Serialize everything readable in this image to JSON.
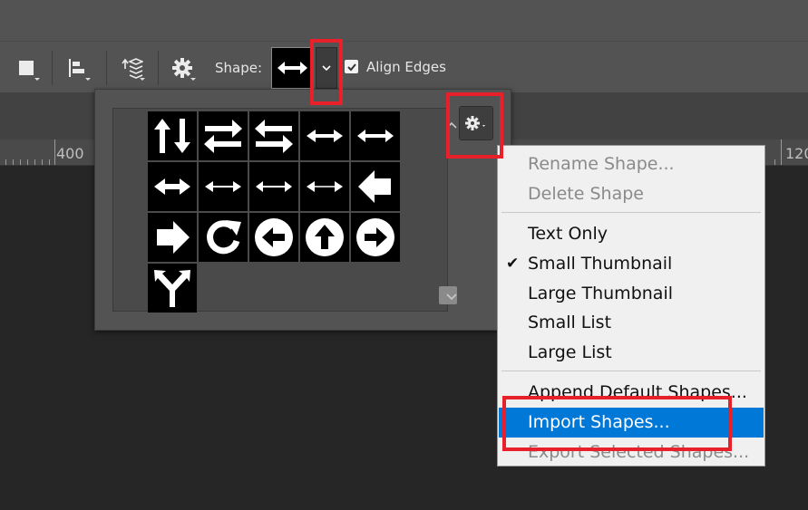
{
  "options_bar": {
    "shape_label": "Shape:",
    "align_edges_label": "Align Edges",
    "align_edges_checked": true
  },
  "ruler": {
    "left_value": "400",
    "right_value": "120"
  },
  "shape_grid": {
    "shapes": [
      "arrows-up-down",
      "arrows-swap-right-left",
      "arrows-swap-left-right",
      "double-arrow-thick",
      "double-arrow-medium",
      "double-arrow-bold",
      "double-arrow-thin",
      "double-arrow-light",
      "double-arrow-hairline",
      "arrow-left-block",
      "arrow-right-block",
      "rotate-clockwise",
      "circle-arrow-left",
      "circle-arrow-up",
      "circle-arrow-right",
      "fork-up"
    ]
  },
  "menu": {
    "items": [
      {
        "label": "Rename Shape...",
        "enabled": false
      },
      {
        "label": "Delete Shape",
        "enabled": false
      },
      {
        "label": "Text Only",
        "enabled": true
      },
      {
        "label": "Small Thumbnail",
        "enabled": true,
        "checked": true
      },
      {
        "label": "Large Thumbnail",
        "enabled": true
      },
      {
        "label": "Small List",
        "enabled": true
      },
      {
        "label": "Large List",
        "enabled": true
      },
      {
        "label": "Append Default Shapes...",
        "enabled": true
      },
      {
        "label": "Import Shapes...",
        "enabled": true,
        "highlighted": true
      },
      {
        "label": "Export Selected Shapes...",
        "enabled": false
      }
    ]
  },
  "colors": {
    "highlight": "#0078d7",
    "annotation": "#e8202a"
  }
}
